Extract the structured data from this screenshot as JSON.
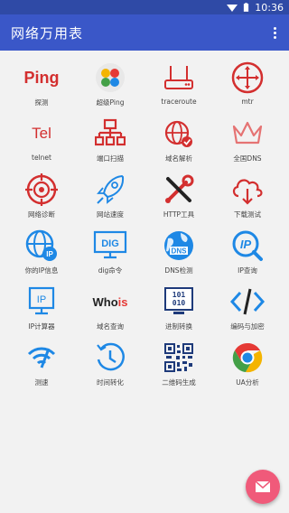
{
  "status": {
    "time": "10:36"
  },
  "app": {
    "title": "网络万用表"
  },
  "tools": [
    {
      "label": "探测",
      "icon": "ping-text-icon",
      "text": "Ping"
    },
    {
      "label": "超级Ping",
      "icon": "super-ping-icon"
    },
    {
      "label": "traceroute",
      "icon": "router-icon"
    },
    {
      "label": "mtr",
      "icon": "mtr-compass-icon"
    },
    {
      "label": "telnet",
      "icon": "telnet-text-icon",
      "text": "Tel"
    },
    {
      "label": "端口扫描",
      "icon": "port-tree-icon"
    },
    {
      "label": "域名解析",
      "icon": "globe-check-icon"
    },
    {
      "label": "全国DNS",
      "icon": "crown-icon"
    },
    {
      "label": "网络诊断",
      "icon": "target-icon"
    },
    {
      "label": "网站速度",
      "icon": "rocket-icon"
    },
    {
      "label": "HTTP工具",
      "icon": "tools-icon"
    },
    {
      "label": "下载测试",
      "icon": "cloud-download-icon"
    },
    {
      "label": "你的IP信息",
      "icon": "globe-ip-icon"
    },
    {
      "label": "dig命令",
      "icon": "dig-monitor-icon",
      "text": "DIG"
    },
    {
      "label": "DNS检测",
      "icon": "dns-globe-icon",
      "text": "DNS"
    },
    {
      "label": "IP查询",
      "icon": "ip-search-icon",
      "text": "IP"
    },
    {
      "label": "IP计算器",
      "icon": "ip-monitor-icon",
      "text": "IP"
    },
    {
      "label": "域名查询",
      "icon": "whois-text-icon",
      "text": "Who",
      "text2": "is"
    },
    {
      "label": "进制转换",
      "icon": "binary-monitor-icon",
      "text": "101",
      "text2": "010"
    },
    {
      "label": "编码与加密",
      "icon": "code-icon"
    },
    {
      "label": "测速",
      "icon": "speed-wifi-icon"
    },
    {
      "label": "时间转化",
      "icon": "time-history-icon"
    },
    {
      "label": "二维码生成",
      "icon": "qrcode-icon"
    },
    {
      "label": "UA分析",
      "icon": "chrome-icon"
    }
  ],
  "colors": {
    "appbar": "#3a57c8",
    "red": "#d32f2f",
    "blue": "#1e88e5",
    "fab": "#f05a7a"
  }
}
